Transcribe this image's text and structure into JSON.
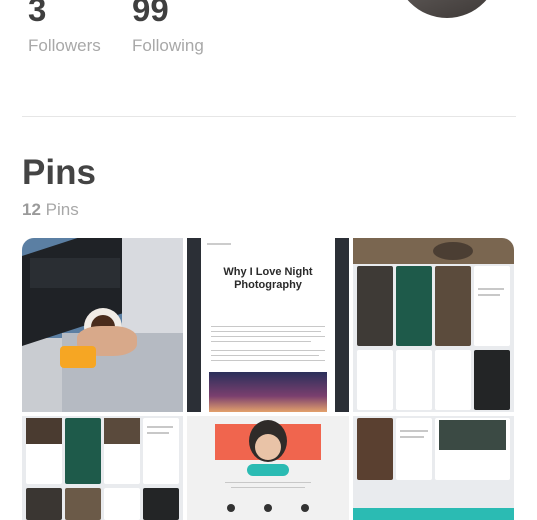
{
  "profile": {
    "followers_count": "3",
    "followers_label": "Followers",
    "following_count": "99",
    "following_label": "Following"
  },
  "pins_section": {
    "title": "Pins",
    "count": "12",
    "count_label": "Pins"
  },
  "pins": [
    {
      "name": "coffee-laptop-photo"
    },
    {
      "name": "night-photography-article",
      "title": "Why I Love Night Photography"
    },
    {
      "name": "app-screens-collage-1"
    },
    {
      "name": "app-screens-collage-2"
    },
    {
      "name": "profile-landing-page"
    },
    {
      "name": "app-screens-collage-3"
    }
  ],
  "colors": {
    "accent_teal": "#2bbbb3",
    "accent_coral": "#f0654e"
  }
}
